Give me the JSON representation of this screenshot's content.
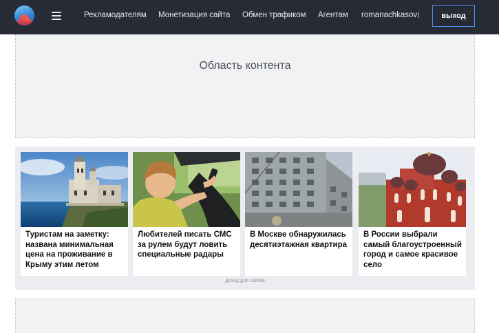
{
  "header": {
    "nav": [
      "Рекламодателям",
      "Монетизация сайта",
      "Обмен трафиком",
      "Агентам"
    ],
    "user": "romanachkasov@",
    "logout": "выход"
  },
  "content_area": {
    "label": "Область контента"
  },
  "feed": {
    "cards": [
      {
        "title": "Туристам на заметку: названа минимальная цена на проживание в Крыму этим летом"
      },
      {
        "title": "Любителей писать СМС за рулем будут ловить специальные радары"
      },
      {
        "title": "В Москве обнаружилась десятиэтажная квартира"
      },
      {
        "title": "В России выбрали самый благоустроенный город и самое красивое село"
      }
    ],
    "income_label": "Доход для сайтов"
  },
  "colors": {
    "header_bg": "#262b36",
    "accent": "#4c8df0"
  }
}
